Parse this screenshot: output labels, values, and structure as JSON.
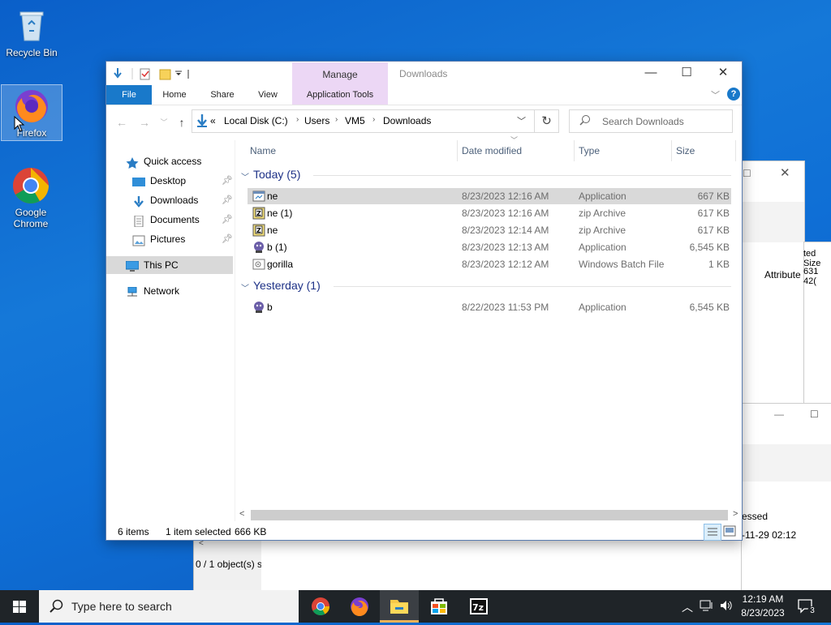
{
  "desktop": {
    "icons": [
      {
        "label": "Recycle Bin"
      },
      {
        "label": "Firefox"
      },
      {
        "label": "Google\nChrome"
      }
    ]
  },
  "background_windows": {
    "partial_texts": [
      "ted Size",
      "631 42(",
      "Attribute",
      "essed",
      "-11-29 02:12",
      "0 / 1 object(s) s"
    ]
  },
  "explorer": {
    "title": "Downloads",
    "manage_label": "Manage",
    "ribbon_tabs": [
      "File",
      "Home",
      "Share",
      "View",
      "Application Tools"
    ],
    "address": {
      "overflow": "«",
      "crumbs": [
        "Local Disk (C:)",
        "Users",
        "VM5",
        "Downloads"
      ]
    },
    "search_placeholder": "Search Downloads",
    "nav": {
      "quick_access": "Quick access",
      "items": [
        {
          "label": "Desktop"
        },
        {
          "label": "Downloads"
        },
        {
          "label": "Documents"
        },
        {
          "label": "Pictures"
        }
      ],
      "this_pc": "This PC",
      "network": "Network"
    },
    "columns": {
      "name": "Name",
      "date": "Date modified",
      "type": "Type",
      "size": "Size"
    },
    "groups": [
      {
        "label": "Today (5)",
        "rows": [
          {
            "name": "ne",
            "date": "8/23/2023 12:16 AM",
            "type": "Application",
            "size": "667 KB",
            "icon": "app-icon",
            "selected": true
          },
          {
            "name": "ne (1)",
            "date": "8/23/2023 12:16 AM",
            "type": "zip Archive",
            "size": "617 KB",
            "icon": "zip-icon"
          },
          {
            "name": "ne",
            "date": "8/23/2023 12:14 AM",
            "type": "zip Archive",
            "size": "617 KB",
            "icon": "zip-icon"
          },
          {
            "name": "b (1)",
            "date": "8/23/2023 12:13 AM",
            "type": "Application",
            "size": "6,545 KB",
            "icon": "app-icon"
          },
          {
            "name": "gorilla",
            "date": "8/23/2023 12:12 AM",
            "type": "Windows Batch File",
            "size": "1 KB",
            "icon": "batch-icon"
          }
        ]
      },
      {
        "label": "Yesterday (1)",
        "rows": [
          {
            "name": "b",
            "date": "8/22/2023 11:53 PM",
            "type": "Application",
            "size": "6,545 KB",
            "icon": "app-icon"
          }
        ]
      }
    ],
    "status": {
      "items": "6 items",
      "selected": "1 item selected",
      "size": "666 KB"
    }
  },
  "taskbar": {
    "search_placeholder": "Type here to search",
    "time": "12:19 AM",
    "date": "8/23/2023",
    "notification_count": "3"
  }
}
